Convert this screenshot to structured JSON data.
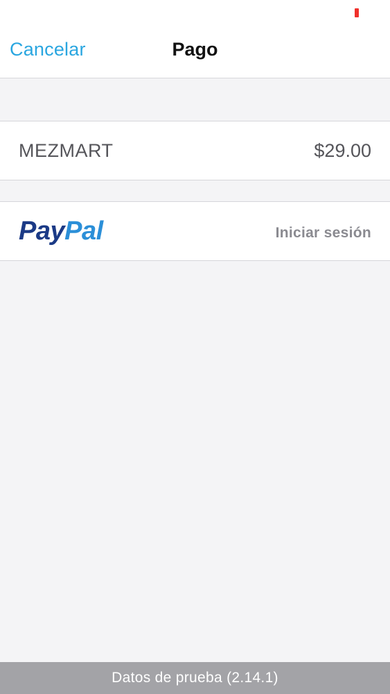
{
  "nav": {
    "cancel_label": "Cancelar",
    "title": "Pago"
  },
  "status_bar": {
    "battery_color": "#f0302b"
  },
  "order": {
    "merchant": "MEZMART",
    "amount": "$29.00"
  },
  "payment": {
    "provider_logo_part1": "Pay",
    "provider_logo_part2": "Pal",
    "brand_colors": [
      "#1b3a86",
      "#2b8fd8"
    ],
    "signin_label": "Iniciar sesión"
  },
  "footer": {
    "text": "Datos de prueba (2.14.1)"
  },
  "colors": {
    "accent": "#2aa6e0",
    "background": "#f4f4f6"
  }
}
